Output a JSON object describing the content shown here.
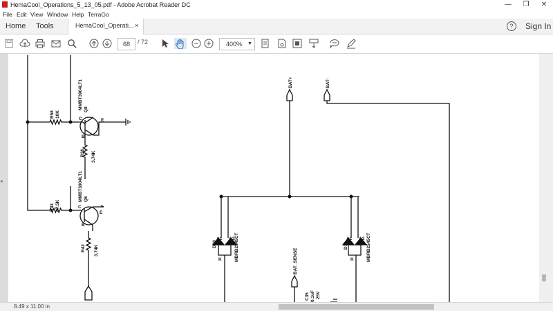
{
  "window": {
    "title": "HemaCool_Operations_5_13_05.pdf - Adobe Acrobat Reader DC"
  },
  "menu": [
    "File",
    "Edit",
    "View",
    "Window",
    "Help",
    "TerraGo"
  ],
  "tabs": {
    "home": "Home",
    "tools": "Tools",
    "document": "HemaCool_Operati...",
    "close": "×",
    "sign_in": "Sign In",
    "help": "?"
  },
  "toolbar": {
    "page_current": "68",
    "page_total": "/ 72",
    "zoom": "400%"
  },
  "status": {
    "page_size": "8.49 x 11.00 in"
  },
  "schematic": {
    "q8_part": "MMBT3904LT1",
    "q8_ref": "Q8",
    "q6_part": "MMBT3904LT1",
    "q6_ref": "Q6",
    "r58_ref": "R58",
    "r58_val": "10K",
    "r38_ref": "R38",
    "r38_val": "3.74K",
    "r43_ref": "R43",
    "r43_val": "47.5K",
    "r42_ref": "R42",
    "r42_val": "3.74K",
    "pin_c": "C",
    "pin_b": "B",
    "pin_e": "E",
    "bat_plus": "BAT+",
    "bat_minus": "BAT-",
    "bat_sense": "BAT_SENSE",
    "d10_ref": "D10",
    "d11_ref": "D11",
    "diode_part": "MBRB2545CT",
    "a1": "A1",
    "a2": "A2",
    "k": "K",
    "c35_ref": "C35",
    "c35_val": "0.1uF",
    "c35_volt": "25V"
  }
}
